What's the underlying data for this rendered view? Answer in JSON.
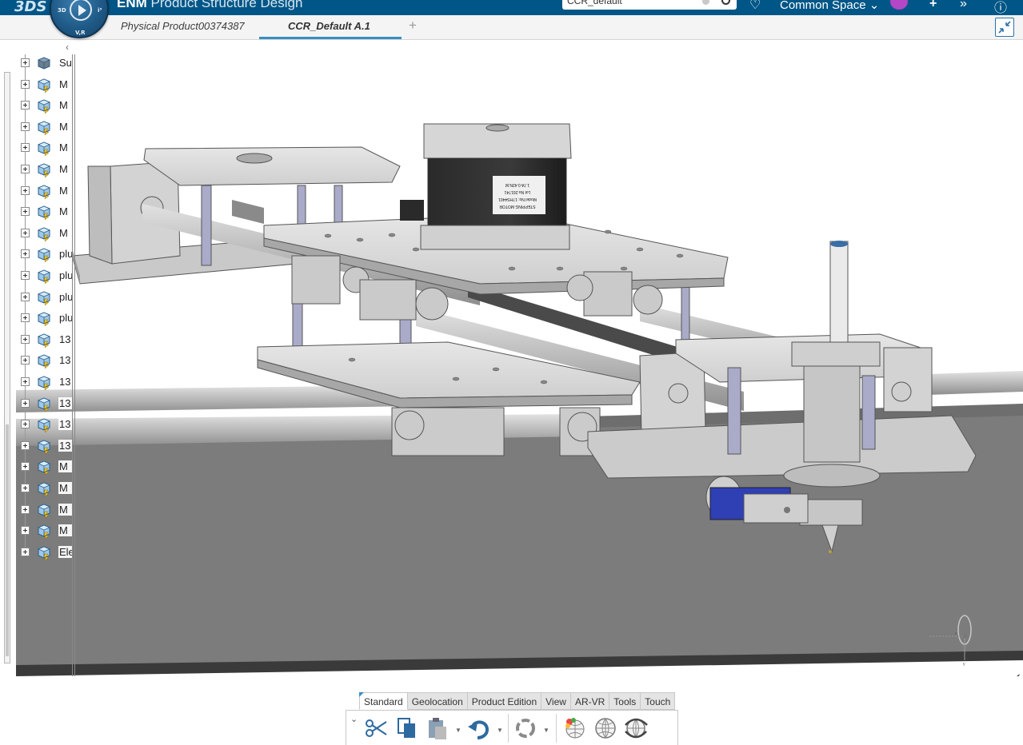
{
  "header": {
    "brand": "3DS",
    "compass_labels": {
      "top_left": "3D",
      "bottom": "V,R",
      "top_right": "i³"
    },
    "app_prefix": "ENM",
    "app_name": "Product Structure Design",
    "search_value": "CCR_default",
    "space_label": "Common Space",
    "icons": [
      "bookmark-icon",
      "user-avatar",
      "add-icon",
      "share-icon",
      "help-icon"
    ]
  },
  "tabs": [
    {
      "label": "Physical Product00374387",
      "active": false
    },
    {
      "label": "CCR_Default A.1",
      "active": true
    }
  ],
  "tab_add_label": "+",
  "tree": {
    "collapse_label": "‹",
    "rows": [
      {
        "name": "Su",
        "icon": "sub-assembly-cube-icon"
      },
      {
        "name": "M",
        "icon": "part-cube-icon"
      },
      {
        "name": "M",
        "icon": "part-cube-icon"
      },
      {
        "name": "M",
        "icon": "part-cube-icon"
      },
      {
        "name": "M",
        "icon": "part-cube-icon"
      },
      {
        "name": "M",
        "icon": "part-cube-icon"
      },
      {
        "name": "M",
        "icon": "part-cube-icon"
      },
      {
        "name": "M",
        "icon": "part-cube-icon"
      },
      {
        "name": "M",
        "icon": "part-cube-icon"
      },
      {
        "name": "plu",
        "icon": "part-cube-icon"
      },
      {
        "name": "plu",
        "icon": "part-cube-icon"
      },
      {
        "name": "plu",
        "icon": "part-cube-icon"
      },
      {
        "name": "plu",
        "icon": "part-cube-icon"
      },
      {
        "name": "13",
        "icon": "part-cube-icon"
      },
      {
        "name": "13",
        "icon": "part-cube-icon"
      },
      {
        "name": "13",
        "icon": "part-cube-icon"
      },
      {
        "name": "13",
        "icon": "part-cube-icon"
      },
      {
        "name": "13",
        "icon": "part-cube-icon"
      },
      {
        "name": "13",
        "icon": "part-cube-icon"
      },
      {
        "name": "M",
        "icon": "part-cube-icon"
      },
      {
        "name": "M",
        "icon": "part-cube-icon"
      },
      {
        "name": "M",
        "icon": "part-cube-icon"
      },
      {
        "name": "M",
        "icon": "part-cube-icon"
      },
      {
        "name": "Ele",
        "icon": "part-cube-icon"
      }
    ]
  },
  "model": {
    "motor_label_lines": [
      "STEPPING MOTOR",
      "Model No: 17HS4401",
      "Lot No:201741",
      "1.7A 0.42N.M"
    ]
  },
  "action_bar": {
    "tabs": [
      {
        "label": "Standard",
        "active": true
      },
      {
        "label": "Geolocation",
        "active": false
      },
      {
        "label": "Product Edition",
        "active": false
      },
      {
        "label": "View",
        "active": false
      },
      {
        "label": "AR-VR",
        "active": false
      },
      {
        "label": "Tools",
        "active": false
      },
      {
        "label": "Touch",
        "active": false
      }
    ],
    "tools": [
      "cut-icon",
      "copy-icon",
      "paste-icon",
      "undo-icon",
      "update-icon",
      "render-style-icon",
      "globe-icon",
      "rotate-globe-icon"
    ],
    "collapse_label": "⌄"
  },
  "colors": {
    "header_bg": "#005686",
    "accent": "#368ec4",
    "ground": "#7a7a7a",
    "metal": "#c8c8c8"
  }
}
